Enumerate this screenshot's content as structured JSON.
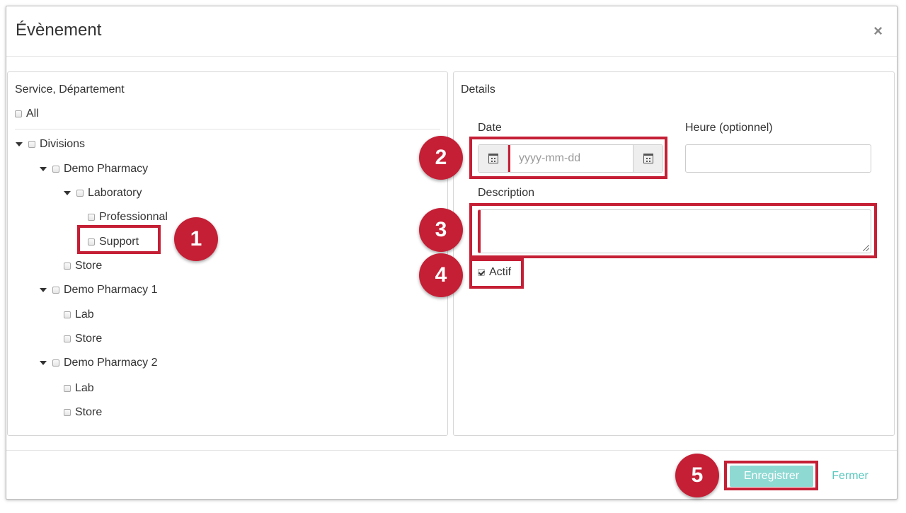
{
  "modal": {
    "title": "Évènement",
    "close_glyph": "×"
  },
  "left_panel": {
    "heading": "Service, Département",
    "all_label": "All",
    "tree": {
      "divisions": "Divisions",
      "demo_pharmacy": "Demo Pharmacy",
      "laboratory": "Laboratory",
      "professionnal": "Professionnal",
      "support": "Support",
      "store_1": "Store",
      "demo_pharmacy_1": "Demo Pharmacy 1",
      "lab_1": "Lab",
      "store_2": "Store",
      "demo_pharmacy_2": "Demo Pharmacy 2",
      "lab_2": "Lab",
      "store_3": "Store"
    }
  },
  "right_panel": {
    "heading": "Details",
    "date_label": "Date",
    "date_placeholder": "yyyy-mm-dd",
    "time_label": "Heure (optionnel)",
    "description_label": "Description",
    "actif_label": "Actif",
    "actif_checked": true
  },
  "footer": {
    "save_label": "Enregistrer",
    "close_label": "Fermer"
  },
  "annotations": {
    "b1": "1",
    "b2": "2",
    "b3": "3",
    "b4": "4",
    "b5": "5"
  },
  "colors": {
    "highlight": "#c51f35",
    "save_button": "#8fd9d3",
    "close_link": "#5ac8bf"
  },
  "icons": [
    "close-icon",
    "caret-down-icon",
    "calendar-icon",
    "checkbox-icon",
    "resize-grip-icon"
  ]
}
